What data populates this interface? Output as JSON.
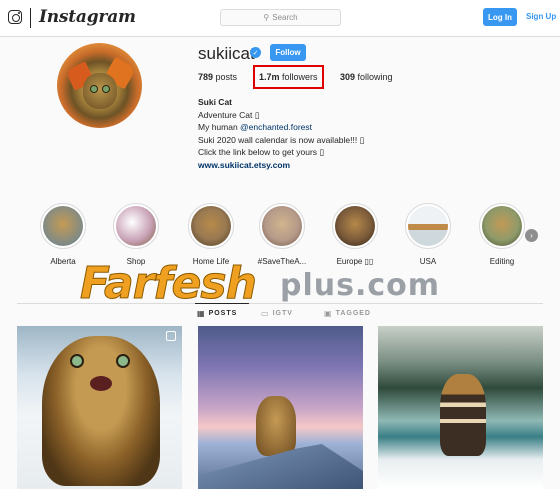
{
  "header": {
    "brand": "Instagram",
    "search_placeholder": "Search",
    "login_label": "Log In",
    "signup_label": "Sign Up"
  },
  "profile": {
    "username": "sukiicat",
    "verified_mark": "✓",
    "follow_label": "Follow",
    "stats": {
      "posts_count": "789",
      "posts_label": "posts",
      "followers_count": "1.7m",
      "followers_label": "followers",
      "following_count": "309",
      "following_label": "following"
    },
    "bio": {
      "name": "Suki Cat",
      "line1": "Adventure Cat ▯",
      "line2_prefix": "My human ",
      "line2_mention": "@enchanted.forest",
      "line3": "Suki 2020 wall calendar is now available!!! ▯",
      "line4": "Click the link below to get yours ▯",
      "website": "www.sukiicat.etsy.com"
    }
  },
  "highlights": [
    {
      "label": "Alberta",
      "color": "#7d8a86"
    },
    {
      "label": "Shop",
      "color": "#c9a3b8"
    },
    {
      "label": "Home Life",
      "color": "#9a7a52"
    },
    {
      "label": "#SaveTheA...",
      "color": "#b59a8a"
    },
    {
      "label": "Europe ▯▯",
      "color": "#7a5a3a"
    },
    {
      "label": "USA",
      "color": "#cfd8dc"
    },
    {
      "label": "Editing",
      "color": "#8f9a6a"
    }
  ],
  "highlights_next_icon": "chevron-right-icon",
  "watermark": {
    "part1": "Farfesh",
    "part2": "plus.com"
  },
  "tabs": [
    {
      "label": "POSTS",
      "icon": "▦"
    },
    {
      "label": "IGTV",
      "icon": "▭"
    },
    {
      "label": "TAGGED",
      "icon": "▣"
    }
  ],
  "colors": {
    "accent": "#3897f0",
    "highlight_box": "#e00000"
  }
}
